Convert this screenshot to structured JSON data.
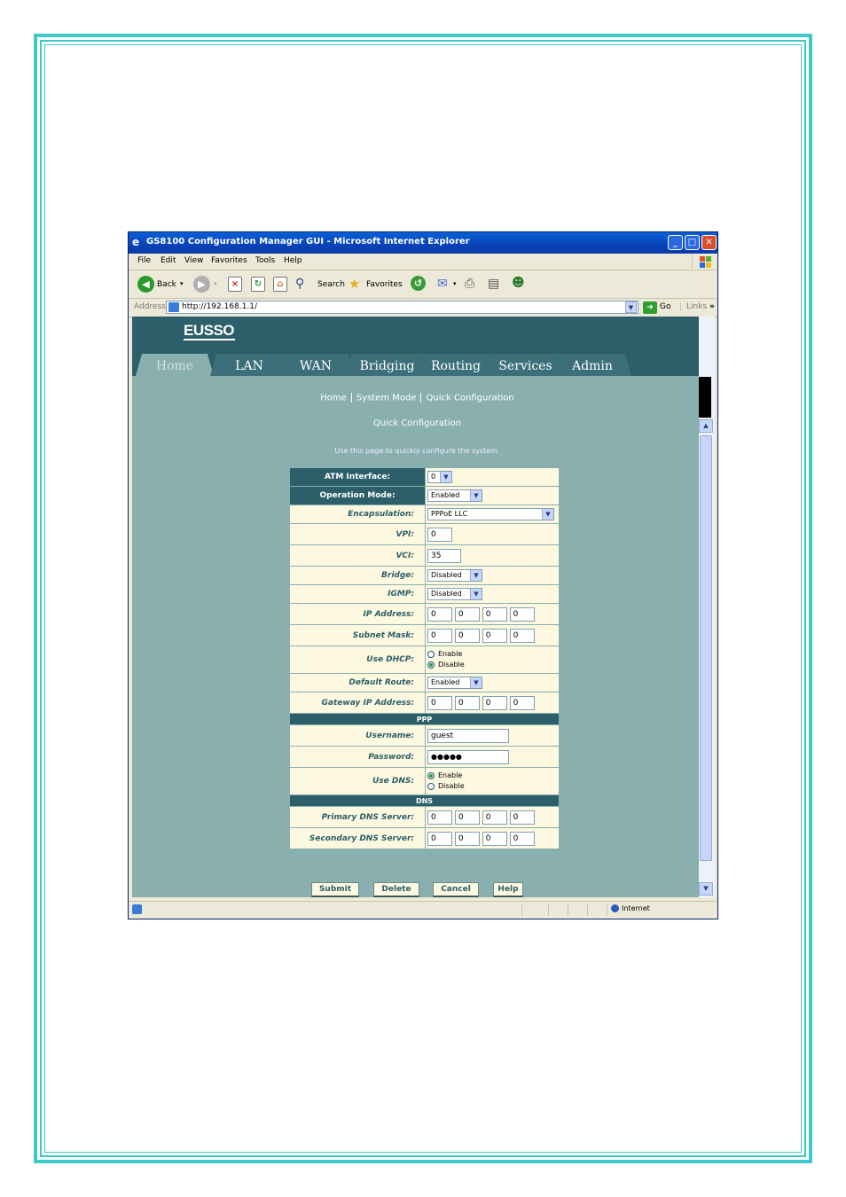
{
  "window": {
    "title": "GS8100 Configuration Manager GUI - Microsoft Internet Explorer",
    "minimize": "_",
    "maximize": "□",
    "close": "✕"
  },
  "menu": [
    "File",
    "Edit",
    "View",
    "Favorites",
    "Tools",
    "Help"
  ],
  "toolbar": {
    "back": "Back",
    "search": "Search",
    "favorites": "Favorites"
  },
  "address": {
    "label": "Address",
    "url": "http://192.168.1.1/",
    "go": "Go",
    "links": "Links"
  },
  "site": {
    "logo": "EUSSO",
    "tabs": [
      "Home",
      "LAN",
      "WAN",
      "Bridging",
      "Routing",
      "Services",
      "Admin"
    ],
    "active_tab": "Home"
  },
  "breadcrumb": [
    "Home",
    "System Mode",
    "Quick Configuration"
  ],
  "page": {
    "title": "Quick Configuration",
    "description": "Use this page to quickly configure the system."
  },
  "form": {
    "atm_interface": {
      "label": "ATM Interface:",
      "value": "0"
    },
    "operation_mode": {
      "label": "Operation Mode:",
      "value": "Enabled"
    },
    "encapsulation": {
      "label": "Encapsulation:",
      "value": "PPPoE LLC"
    },
    "vpi": {
      "label": "VPI:",
      "value": "0"
    },
    "vci": {
      "label": "VCI:",
      "value": "35"
    },
    "bridge": {
      "label": "Bridge:",
      "value": "Disabled"
    },
    "igmp": {
      "label": "IGMP:",
      "value": "Disabled"
    },
    "ip_address": {
      "label": "IP Address:",
      "octets": [
        "0",
        "0",
        "0",
        "0"
      ]
    },
    "subnet_mask": {
      "label": "Subnet Mask:",
      "octets": [
        "0",
        "0",
        "0",
        "0"
      ]
    },
    "use_dhcp": {
      "label": "Use DHCP:",
      "options": [
        "Enable",
        "Disable"
      ],
      "selected": "Disable"
    },
    "default_route": {
      "label": "Default Route:",
      "value": "Enabled"
    },
    "gateway": {
      "label": "Gateway IP Address:",
      "octets": [
        "0",
        "0",
        "0",
        "0"
      ]
    },
    "ppp_section": "PPP",
    "username": {
      "label": "Username:",
      "value": "guest"
    },
    "password": {
      "label": "Password:",
      "value": "●●●●●"
    },
    "use_dns": {
      "label": "Use DNS:",
      "options": [
        "Enable",
        "Disable"
      ],
      "selected": "Enable"
    },
    "dns_section": "DNS",
    "primary_dns": {
      "label": "Primary DNS Server:",
      "octets": [
        "0",
        "0",
        "0",
        "0"
      ]
    },
    "secondary_dns": {
      "label": "Secondary DNS Server:",
      "octets": [
        "0",
        "0",
        "0",
        "0"
      ]
    }
  },
  "buttons": {
    "submit": "Submit",
    "delete": "Delete",
    "cancel": "Cancel",
    "help": "Help"
  },
  "statusbar": {
    "zone": "Internet"
  },
  "colors": {
    "frame": "#3fc8c8",
    "header": "#2c5f69",
    "page_bg": "#8aafaf",
    "form_bg": "#fdf8e0"
  }
}
